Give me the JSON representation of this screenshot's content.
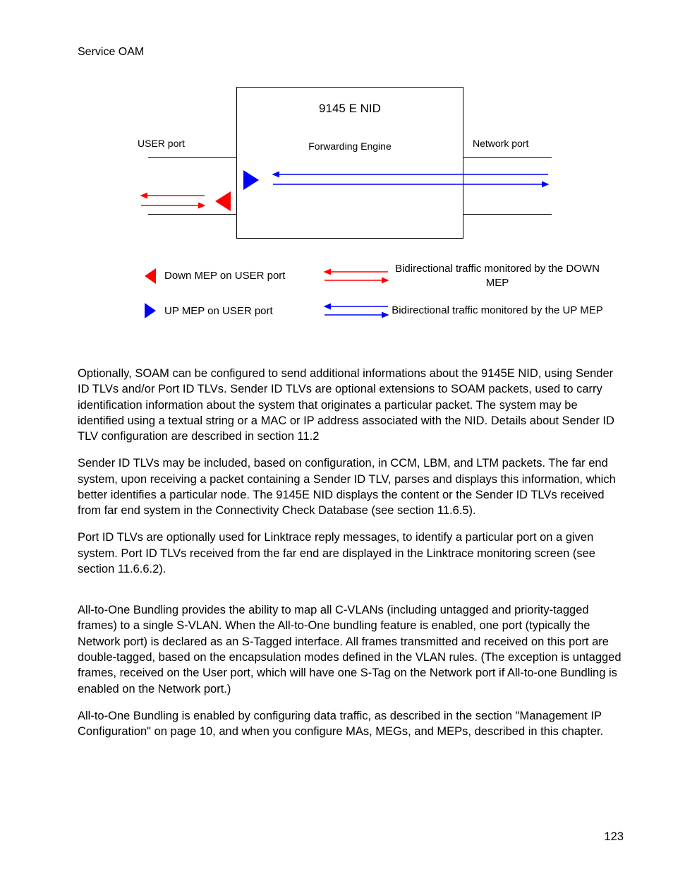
{
  "header": "Service OAM",
  "diagram": {
    "title": "9145 E NID",
    "forwarding": "Forwarding Engine",
    "user_port": "USER port",
    "network_port": "Network port"
  },
  "legend": {
    "down_mep": "Down MEP on USER port",
    "up_mep": "UP MEP on USER port",
    "down_traffic": "Bidirectional traffic monitored by the DOWN MEP",
    "up_traffic": "Bidirectional traffic monitored by the UP MEP"
  },
  "paragraphs": {
    "p1": "Optionally, SOAM can be configured to send additional informations about the 9145E NID, using Sender ID TLVs and/or Port ID TLVs. Sender ID TLVs are optional extensions to SOAM packets, used to carry identification information about the system that originates a particular packet. The system may be identified using a textual string or a MAC or IP address associated with the NID. Details about Sender ID TLV configuration are described in section 11.2",
    "p2": "Sender ID TLVs may be included, based on configuration, in CCM, LBM, and LTM packets. The far end system, upon receiving a packet containing a Sender ID TLV, parses and displays this information, which better identifies a particular node. The 9145E NID displays the content or the Sender ID TLVs received from far end system in the Connectivity Check Database (see section 11.6.5).",
    "p3": "Port ID TLVs are optionally used for Linktrace reply messages, to identify a particular port on a given system. Port ID TLVs received from the far end are displayed in the Linktrace monitoring screen (see section 11.6.6.2).",
    "p4": "All-to-One Bundling provides the ability to map all C-VLANs (including untagged and priority-tagged frames) to a single S-VLAN. When the All-to-One bundling feature is enabled, one port (typically the Network port) is declared as an S-Tagged interface. All frames transmitted and received on this port are double-tagged, based on the encapsulation modes defined in the VLAN rules. (The exception is untagged frames, received on the User port, which will  have one S-Tag on the Network port if All-to-one Bundling is enabled on the Network port.)",
    "p5": "All-to-One Bundling is enabled by configuring data traffic, as described in the section \"Management IP Configuration\" on page 10, and when you configure MAs, MEGs, and MEPs, described in this chapter."
  },
  "page_number": "123"
}
